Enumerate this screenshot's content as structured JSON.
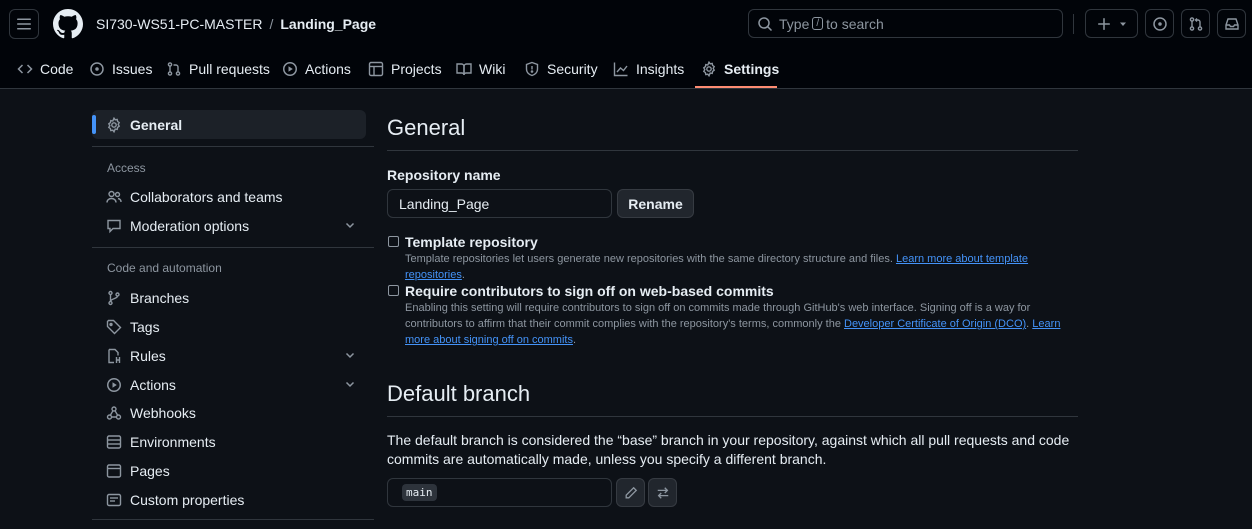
{
  "header": {
    "owner": "SI730-WS51-PC-MASTER",
    "separator": "/",
    "repo": "Landing_Page",
    "search": {
      "prefix": "Type",
      "key": "/",
      "suffix": "to search"
    }
  },
  "tabs": [
    {
      "label": "Code",
      "icon": "code-icon"
    },
    {
      "label": "Issues",
      "icon": "issue-icon"
    },
    {
      "label": "Pull requests",
      "icon": "pull-request-icon"
    },
    {
      "label": "Actions",
      "icon": "play-icon"
    },
    {
      "label": "Projects",
      "icon": "table-icon"
    },
    {
      "label": "Wiki",
      "icon": "book-icon"
    },
    {
      "label": "Security",
      "icon": "shield-icon"
    },
    {
      "label": "Insights",
      "icon": "graph-icon"
    },
    {
      "label": "Settings",
      "icon": "gear-icon",
      "active": true
    }
  ],
  "sidebar": {
    "general": "General",
    "access_heading": "Access",
    "access_items": [
      {
        "label": "Collaborators and teams",
        "icon": "people-icon"
      },
      {
        "label": "Moderation options",
        "icon": "comment-icon",
        "expandable": true
      }
    ],
    "code_heading": "Code and automation",
    "code_items": [
      {
        "label": "Branches",
        "icon": "branch-icon"
      },
      {
        "label": "Tags",
        "icon": "tag-icon"
      },
      {
        "label": "Rules",
        "icon": "rules-icon",
        "expandable": true
      },
      {
        "label": "Actions",
        "icon": "play-icon",
        "expandable": true
      },
      {
        "label": "Webhooks",
        "icon": "webhook-icon"
      },
      {
        "label": "Environments",
        "icon": "server-icon"
      },
      {
        "label": "Pages",
        "icon": "browser-icon"
      },
      {
        "label": "Custom properties",
        "icon": "note-icon"
      }
    ]
  },
  "main": {
    "title": "General",
    "repo_name_label": "Repository name",
    "repo_name_value": "Landing_Page",
    "rename_label": "Rename",
    "template": {
      "title": "Template repository",
      "desc": "Template repositories let users generate new repositories with the same directory structure and files.",
      "link": "Learn more about template repositories",
      "after": "."
    },
    "signoff": {
      "title": "Require contributors to sign off on web-based commits",
      "desc": "Enabling this setting will require contributors to sign off on commits made through GitHub's web interface. Signing off is a way for contributors to affirm that their commit complies with the repository's terms, commonly the",
      "link1": "Developer Certificate of Origin (DCO)",
      "mid": ".",
      "link2": "Learn more about signing off on commits",
      "after": "."
    },
    "default_branch_title": "Default branch",
    "default_branch_desc": "The default branch is considered the “base” branch in your repository, against which all pull requests and code commits are automatically made, unless you specify a different branch.",
    "default_branch_value": "main"
  }
}
